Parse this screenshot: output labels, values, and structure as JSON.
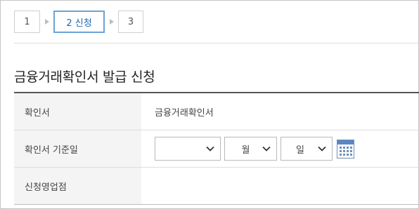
{
  "steps": [
    {
      "label": "1"
    },
    {
      "label": "2 신청"
    },
    {
      "label": "3"
    }
  ],
  "page": {
    "title": "금융거래확인서 발급 신청"
  },
  "form": {
    "rows": [
      {
        "label": "확인서",
        "value": "금융거래확인서"
      },
      {
        "label": "확인서 기준일"
      },
      {
        "label": "신청영업점",
        "value": ""
      }
    ],
    "date": {
      "year_value": "",
      "month_value": "월",
      "day_value": "일"
    }
  },
  "icons": {
    "step_arrow": "triangle-right-icon",
    "select_chevron": "chevron-down-icon",
    "calendar": "calendar-icon"
  },
  "colors": {
    "active_step_border": "#6aa3d6",
    "active_step_text": "#1f66b0",
    "label_bg": "#f4f4f4"
  }
}
